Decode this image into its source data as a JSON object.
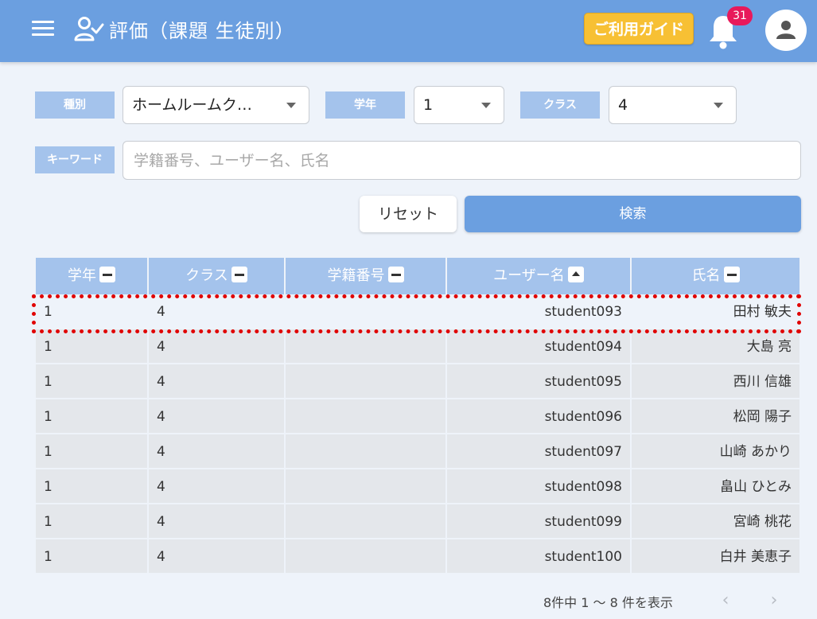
{
  "header": {
    "title": "評価（課題 生徒別）",
    "guide_label": "ご利用ガイド",
    "notification_count": "31",
    "colors": {
      "bar": "#6b9fe0",
      "guide": "#f7c034",
      "badge": "#e8195a"
    }
  },
  "filters": {
    "type_label": "種別",
    "type_value": "ホームルームク…",
    "grade_label": "学年",
    "grade_value": "1",
    "class_label": "クラス",
    "class_value": "4",
    "keyword_label": "キーワード",
    "keyword_placeholder": "学籍番号、ユーザー名、氏名",
    "keyword_value": "",
    "reset_label": "リセット",
    "search_label": "検索"
  },
  "table": {
    "headers": [
      "学年",
      "クラス",
      "学籍番号",
      "ユーザー名",
      "氏名"
    ],
    "sort_states": [
      "none",
      "none",
      "none",
      "asc",
      "none"
    ],
    "rows": [
      {
        "grade": "1",
        "class": "4",
        "student_no": "",
        "username": "student093",
        "name": "田村 敏夫"
      },
      {
        "grade": "1",
        "class": "4",
        "student_no": "",
        "username": "student094",
        "name": "大島 亮"
      },
      {
        "grade": "1",
        "class": "4",
        "student_no": "",
        "username": "student095",
        "name": "西川 信雄"
      },
      {
        "grade": "1",
        "class": "4",
        "student_no": "",
        "username": "student096",
        "name": "松岡 陽子"
      },
      {
        "grade": "1",
        "class": "4",
        "student_no": "",
        "username": "student097",
        "name": "山崎 あかり"
      },
      {
        "grade": "1",
        "class": "4",
        "student_no": "",
        "username": "student098",
        "name": "畠山 ひとみ"
      },
      {
        "grade": "1",
        "class": "4",
        "student_no": "",
        "username": "student099",
        "name": "宮崎 桃花"
      },
      {
        "grade": "1",
        "class": "4",
        "student_no": "",
        "username": "student100",
        "name": "白井 美恵子"
      }
    ]
  },
  "pagination": {
    "summary": "8件中 1 ～ 8 件を表示",
    "prev_label": "‹",
    "next_label": "›"
  }
}
